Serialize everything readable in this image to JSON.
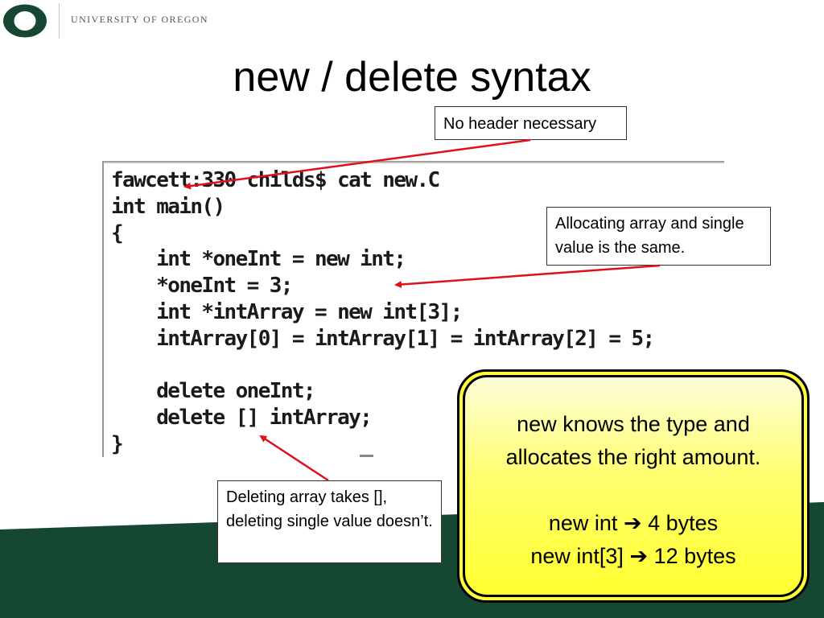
{
  "header": {
    "institution": "UNIVERSITY OF OREGON",
    "logo_icon": "oregon-o-logo-icon",
    "brand_green": "#154733"
  },
  "slide": {
    "title": "new / delete syntax"
  },
  "code": {
    "lines": [
      "fawcett:330 childs$ cat new.C",
      "int main()",
      "{",
      "    int *oneInt = new int;",
      "    *oneInt = 3;",
      "    int *intArray = new int[3];",
      "    intArray[0] = intArray[1] = intArray[2] = 5;",
      "",
      "    delete oneInt;",
      "    delete [] intArray;",
      "}"
    ]
  },
  "callouts": {
    "header": "No header necessary",
    "alloc": "Allocating array and single value is the same.",
    "delete": "Deleting array takes [], deleting single value doesn’t."
  },
  "summary": {
    "line1": "new knows the type and",
    "line2": "allocates the right amount.",
    "line3_prefix": "new int ",
    "line3_suffix": " 4 bytes",
    "line4_prefix": "new int[3] ",
    "line4_suffix": " 12 bytes",
    "arrow_icon": "right-arrow-icon",
    "fill_color": "#ffff3a"
  },
  "annotation_arrow_color": "#e0101a"
}
